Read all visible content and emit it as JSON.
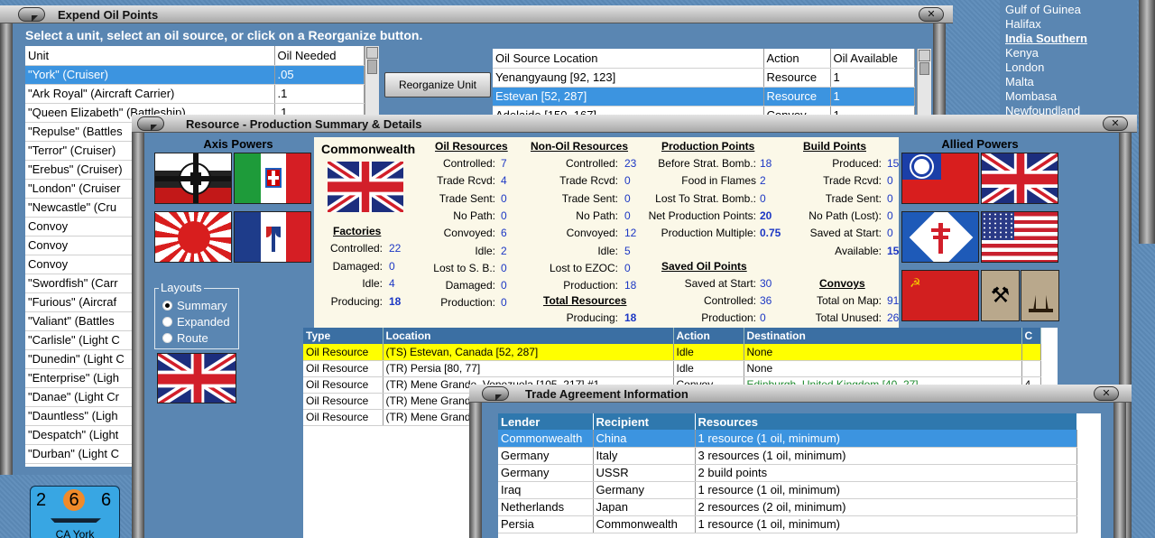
{
  "colors": {
    "selection": "#3c94e0",
    "highlight": "#ffff00",
    "link": "#1c37c4",
    "header": "#2f78ae"
  },
  "right_list": {
    "items": [
      {
        "label": "Gulf of Guinea",
        "active": false
      },
      {
        "label": "Halifax",
        "active": false
      },
      {
        "label": "India Southern",
        "active": true
      },
      {
        "label": "Kenya",
        "active": false
      },
      {
        "label": "London",
        "active": false
      },
      {
        "label": "Malta",
        "active": false
      },
      {
        "label": "Mombasa",
        "active": false
      },
      {
        "label": "Newfoundland",
        "active": false
      }
    ]
  },
  "expend": {
    "title": "Expend Oil Points",
    "instruction": "Select a unit, select an oil source, or click on a Reorganize button.",
    "unit_cols": [
      "Unit",
      "Oil Needed"
    ],
    "units": [
      {
        "unit": "\"York\" (Cruiser)",
        "oil": ".05",
        "sel": true
      },
      {
        "unit": "\"Ark Royal\" (Aircraft Carrier)",
        "oil": ".1"
      },
      {
        "unit": "\"Queen Elizabeth\" (Battleship)",
        "oil": ".1"
      },
      {
        "unit": "\"Repulse\" (Battles",
        "oil": ""
      },
      {
        "unit": "\"Terror\" (Cruiser)",
        "oil": ""
      },
      {
        "unit": "\"Erebus\" (Cruiser)",
        "oil": ""
      },
      {
        "unit": "\"London\" (Cruiser",
        "oil": ""
      },
      {
        "unit": "\"Newcastle\" (Cru",
        "oil": ""
      },
      {
        "unit": "Convoy",
        "oil": ""
      },
      {
        "unit": "Convoy",
        "oil": ""
      },
      {
        "unit": "Convoy",
        "oil": ""
      },
      {
        "unit": "\"Swordfish\" (Carr",
        "oil": ""
      },
      {
        "unit": "\"Furious\" (Aircraf",
        "oil": ""
      },
      {
        "unit": "\"Valiant\" (Battles",
        "oil": ""
      },
      {
        "unit": "\"Carlisle\" (Light C",
        "oil": ""
      },
      {
        "unit": "\"Dunedin\" (Light C",
        "oil": ""
      },
      {
        "unit": "\"Enterprise\" (Ligh",
        "oil": ""
      },
      {
        "unit": "\"Danae\" (Light Cr",
        "oil": ""
      },
      {
        "unit": "\"Dauntless\" (Ligh",
        "oil": ""
      },
      {
        "unit": "\"Despatch\" (Light",
        "oil": ""
      },
      {
        "unit": "\"Durban\" (Light C",
        "oil": ""
      }
    ],
    "reorg_label": "Reorganize Unit",
    "source_cols": [
      "Oil Source Location",
      "Action",
      "Oil Available"
    ],
    "sources": [
      {
        "loc": "Yenangyaung [92, 123]",
        "action": "Resource",
        "avail": "1"
      },
      {
        "loc": "Estevan [52, 287]",
        "action": "Resource",
        "avail": "1",
        "sel": true
      },
      {
        "loc": "Adelaide [150, 167]",
        "action": "Convoy",
        "avail": "1"
      }
    ],
    "counter": {
      "left": "2",
      "mid": "6",
      "right": "6",
      "name": "CA York"
    }
  },
  "resource": {
    "title": "Resource - Production Summary & Details",
    "axis_label": "Axis Powers",
    "allied_label": "Allied Powers",
    "layouts": {
      "title": "Layouts",
      "options": [
        {
          "label": "Summary",
          "on": true
        },
        {
          "label": "Expanded",
          "on": false
        },
        {
          "label": "Route",
          "on": false
        }
      ]
    },
    "country": "Commonwealth",
    "factories": {
      "title": "Factories",
      "rows": [
        [
          "Controlled:",
          "22"
        ],
        [
          "Damaged:",
          "0"
        ],
        [
          "Idle:",
          "4"
        ],
        [
          "Producing:",
          "18"
        ]
      ]
    },
    "oil": {
      "title": "Oil Resources",
      "rows": [
        [
          "Controlled:",
          "7"
        ],
        [
          "Trade Rcvd:",
          "4"
        ],
        [
          "Trade Sent:",
          "0"
        ],
        [
          "No Path:",
          "0"
        ],
        [
          "Convoyed:",
          "6"
        ],
        [
          "Idle:",
          "2"
        ],
        [
          "Lost to S. B.:",
          "0"
        ],
        [
          "Damaged:",
          "0"
        ],
        [
          "Production:",
          "0"
        ]
      ]
    },
    "nonoil": {
      "title": "Non-Oil Resources",
      "rows": [
        [
          "Controlled:",
          "23"
        ],
        [
          "Trade Rcvd:",
          "0"
        ],
        [
          "Trade Sent:",
          "0"
        ],
        [
          "No Path:",
          "0"
        ],
        [
          "Convoyed:",
          "12"
        ],
        [
          "Idle:",
          "5"
        ],
        [
          "Lost to EZOC:",
          "0"
        ],
        [
          "Production:",
          "18"
        ]
      ]
    },
    "total": {
      "title": "Total Resources",
      "rows": [
        [
          "Producing:",
          "18"
        ]
      ]
    },
    "prod": {
      "title": "Production Points",
      "rows": [
        [
          "Before Strat. Bomb.:",
          "18"
        ],
        [
          "Food in Flames",
          "2"
        ],
        [
          "Lost To Strat. Bomb.:",
          "0"
        ],
        [
          "Net Production Points:",
          "20"
        ],
        [
          "Production Multiple:",
          "0.75"
        ]
      ]
    },
    "saved": {
      "title": "Saved Oil Points",
      "rows": [
        [
          "Saved at Start:",
          "30"
        ],
        [
          "Controlled:",
          "36"
        ],
        [
          "Production:",
          "0"
        ]
      ]
    },
    "build": {
      "title": "Build Points",
      "rows": [
        [
          "Produced:",
          "15"
        ],
        [
          "Trade Rcvd:",
          "0"
        ],
        [
          "Trade Sent:",
          "0"
        ],
        [
          "No Path (Lost):",
          "0"
        ],
        [
          "Saved at Start:",
          "0"
        ],
        [
          "Available:",
          "15"
        ]
      ]
    },
    "convoys": {
      "title": "Convoys",
      "rows": [
        [
          "Total on Map:",
          "91"
        ],
        [
          "Total Unused:",
          "26"
        ]
      ]
    },
    "detail_cols": [
      "Type",
      "Location",
      "Action",
      "Destination",
      "C"
    ],
    "details": [
      {
        "type": "Oil Resource",
        "loc": "(TS) Estevan, Canada [52, 287]",
        "action": "Idle",
        "dest": "None",
        "c": "",
        "yel": true
      },
      {
        "type": "Oil Resource",
        "loc": "(TR) Persia [80, 77]",
        "action": "Idle",
        "dest": "None",
        "c": ""
      },
      {
        "type": "Oil Resource",
        "loc": "(TR) Mene Grande, Venezuela [105, 217] #1",
        "action": "Convoy",
        "dest": "Edinburgh, United Kingdom [40, 27]",
        "c": "4"
      },
      {
        "type": "Oil Resource",
        "loc": "(TR) Mene Grande",
        "action": "",
        "dest": "",
        "c": ""
      },
      {
        "type": "Oil Resource",
        "loc": "(TR) Mene Grande",
        "action": "",
        "dest": "",
        "c": ""
      }
    ]
  },
  "trade": {
    "title": "Trade Agreement Information",
    "cols": [
      "Lender",
      "Recipient",
      "Resources"
    ],
    "rows": [
      {
        "lender": "Commonwealth",
        "recipient": "China",
        "res": "1 resource (1 oil, minimum)",
        "sel": true
      },
      {
        "lender": "Germany",
        "recipient": "Italy",
        "res": "3 resources (1 oil, minimum)"
      },
      {
        "lender": "Germany",
        "recipient": "USSR",
        "res": "2 build points"
      },
      {
        "lender": "Iraq",
        "recipient": "Germany",
        "res": "1 resource (1 oil, minimum)"
      },
      {
        "lender": "Netherlands",
        "recipient": "Japan",
        "res": "2 resources (2 oil, minimum)"
      },
      {
        "lender": "Persia",
        "recipient": "Commonwealth",
        "res": "1 resource (1 oil, minimum)"
      }
    ]
  }
}
